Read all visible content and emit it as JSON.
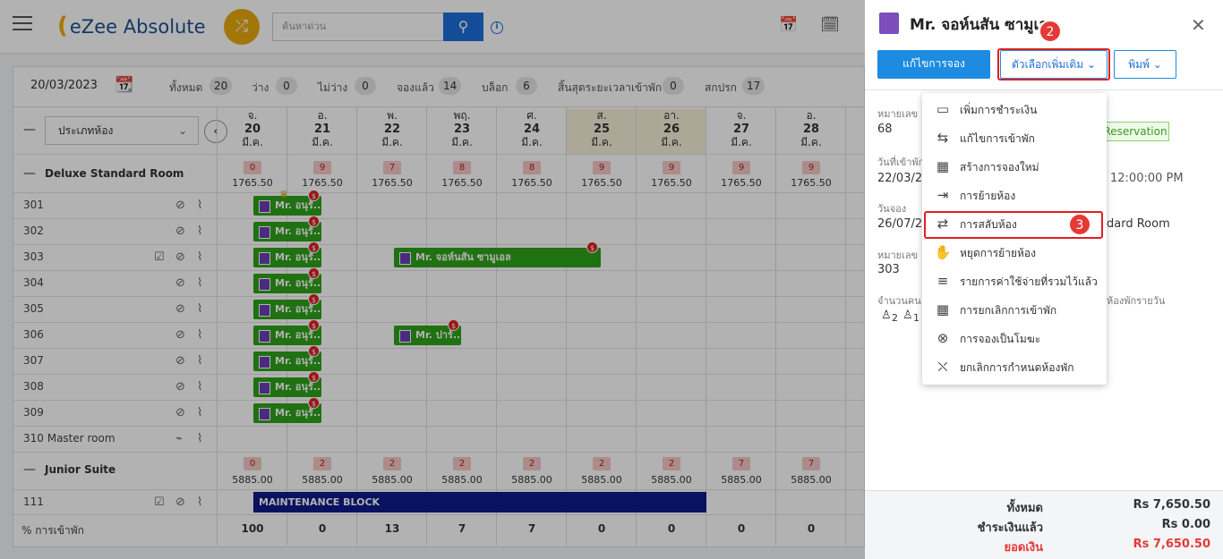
{
  "app": {
    "logo": "eZee Absolute",
    "search_placeholder": "ค้นหาด่วน",
    "info": "i"
  },
  "filter": {
    "date": "20/03/2023",
    "stats": [
      {
        "label": "ทั้งหมด",
        "count": "20"
      },
      {
        "label": "ว่าง",
        "count": "0"
      },
      {
        "label": "ไม่ว่าง",
        "count": "0"
      },
      {
        "label": "จองแล้ว",
        "count": "14"
      },
      {
        "label": "บล็อก",
        "count": "6"
      },
      {
        "label": "สิ้นสุดระยะเวลาเข้าพัก",
        "count": "0"
      },
      {
        "label": "สกปรก",
        "count": "17"
      }
    ]
  },
  "grid": {
    "room_type_select": "ประเภทห้อง",
    "days": [
      {
        "dow": "จ.",
        "day": "20",
        "mon": "มี.ค."
      },
      {
        "dow": "อ.",
        "day": "21",
        "mon": "มี.ค."
      },
      {
        "dow": "พ.",
        "day": "22",
        "mon": "มี.ค."
      },
      {
        "dow": "พฤ.",
        "day": "23",
        "mon": "มี.ค."
      },
      {
        "dow": "ศ.",
        "day": "24",
        "mon": "มี.ค."
      },
      {
        "dow": "ส.",
        "day": "25",
        "mon": "มี.ค."
      },
      {
        "dow": "อา.",
        "day": "26",
        "mon": "มี.ค."
      },
      {
        "dow": "จ.",
        "day": "27",
        "mon": "มี.ค."
      },
      {
        "dow": "อ.",
        "day": "28",
        "mon": "มี.ค."
      }
    ],
    "deluxe": {
      "name": "Deluxe Standard Room",
      "counts": [
        "0",
        "9",
        "7",
        "8",
        "8",
        "9",
        "9",
        "9",
        "9"
      ],
      "rates": [
        "1765.50",
        "1765.50",
        "1765.50",
        "1765.50",
        "1765.50",
        "1765.50",
        "1765.50",
        "1765.50",
        "1765.50"
      ]
    },
    "junior": {
      "name": "Junior Suite",
      "counts": [
        "0",
        "2",
        "2",
        "2",
        "2",
        "2",
        "2",
        "7",
        "7"
      ],
      "rates": [
        "5885.00",
        "5885.00",
        "5885.00",
        "5885.00",
        "5885.00",
        "5885.00",
        "5885.00",
        "5885.00",
        "5885.00"
      ]
    },
    "rooms": [
      "301",
      "302",
      "303",
      "304",
      "305",
      "306",
      "307",
      "308",
      "309",
      "310 Master room"
    ],
    "junior_rooms": [
      "111"
    ],
    "booking_short": "Mr. อนุรั...",
    "booking_303": "Mr. จอห์นสัน ซามูเอล",
    "booking_306": "Mr. ปาร์...",
    "maintenance": "MAINTENANCE BLOCK",
    "occ_label": "% การเข้าพัก",
    "occ": [
      "100",
      "0",
      "13",
      "7",
      "7",
      "0",
      "0",
      "0",
      "0"
    ]
  },
  "panel": {
    "title": "Mr. จอห์นสัน ซามูเอล",
    "edit": "แก้ไขการจอง",
    "more": "ตัวเลือกเพิ่มเติม",
    "print": "พิมพ์",
    "f1_label": "หมายเลข",
    "f1_value": "68",
    "status": "Reservation",
    "f2_label": "วันที่เข้าพัก",
    "f2_value": "22/03/20",
    "time": "12:00:00 PM",
    "f3_label": "วันจอง",
    "f3_value": "26/07/20",
    "roomtype": "dard Room",
    "f4_label": "หมายเลข",
    "f4_value": "303",
    "f5_label": "จำนวนคน",
    "rate_type": "ห้องพักรายวัน",
    "adults": "2",
    "kids": "1",
    "menu": [
      {
        "icon": "card-icon",
        "label": "เพิ่มการชำระเงิน"
      },
      {
        "icon": "edit-stay-icon",
        "label": "แก้ไขการเข้าพัก"
      },
      {
        "icon": "calendar-icon",
        "label": "สร้างการจองใหม่"
      },
      {
        "icon": "move-room-icon",
        "label": "การย้ายห้อง"
      },
      {
        "icon": "swap-room-icon",
        "label": "การสลับห้อง"
      },
      {
        "icon": "hand-icon",
        "label": "หยุดการย้ายห้อง"
      },
      {
        "icon": "expense-icon",
        "label": "รายการค่าใช้จ่ายที่รวมไว้แล้ว"
      },
      {
        "icon": "cancel-calendar-icon",
        "label": "การยกเลิกการเข้าพัก"
      },
      {
        "icon": "x-circle-icon",
        "label": "การจองเป็นโมฆะ"
      },
      {
        "icon": "unassign-room-icon",
        "label": "ยกเลิกการกำหนดห้องพัก"
      }
    ],
    "total_label": "ทั้งหมด",
    "total": "Rs 7,650.50",
    "paid_label": "ชำระเงินแล้ว",
    "paid": "Rs 0.00",
    "balance_label": "ยอดเงิน",
    "balance": "Rs 7,650.50",
    "badge2": "2",
    "badge3": "3"
  }
}
